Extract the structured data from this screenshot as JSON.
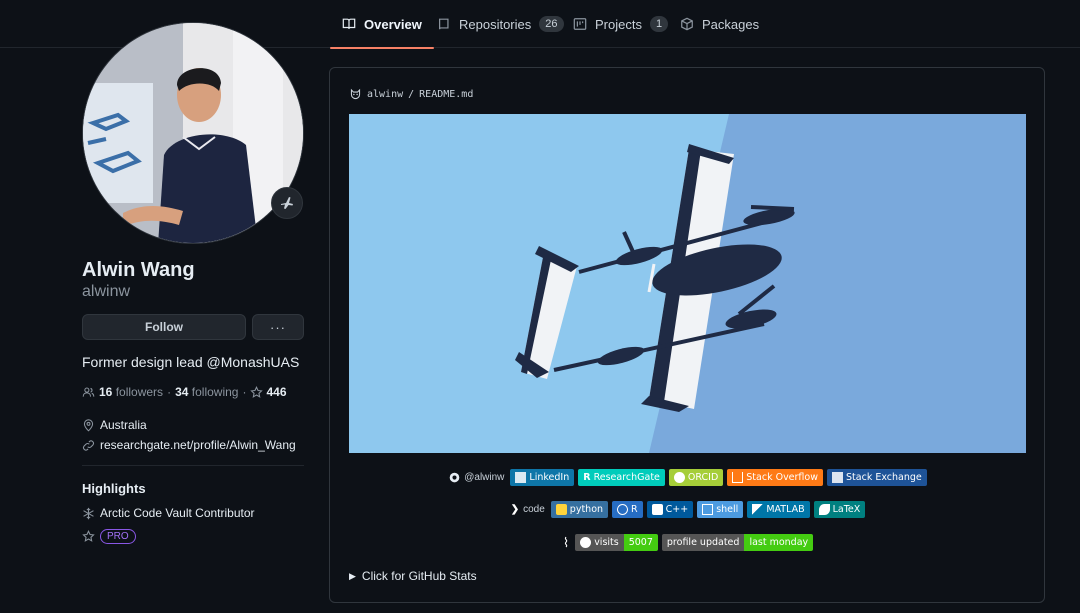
{
  "tabs": [
    {
      "label": "Overview",
      "count": null
    },
    {
      "label": "Repositories",
      "count": "26"
    },
    {
      "label": "Projects",
      "count": "1"
    },
    {
      "label": "Packages",
      "count": null
    }
  ],
  "profile": {
    "full_name": "Alwin Wang",
    "username": "alwinw",
    "follow_label": "Follow",
    "more_label": "···",
    "bio": "Former design lead @MonashUAS",
    "followers_count": "16",
    "followers_label": "followers",
    "following_count": "34",
    "following_label": "following",
    "stars": "446",
    "location": "Australia",
    "website": "researchgate.net/profile/Alwin_Wang",
    "status_icon": "airplane-icon"
  },
  "highlights": {
    "title": "Highlights",
    "items": [
      "Arctic Code Vault Contributor"
    ],
    "pro_label": "PRO"
  },
  "readme": {
    "owner": "alwinw",
    "separator": "/",
    "file": "README.md",
    "banner_colors": {
      "left": "#8ec8ee",
      "right": "#7aa9dc",
      "body": "#f1f3f6",
      "accent": "#1f2a44"
    },
    "social": {
      "handle": "@alwinw",
      "badges": [
        {
          "label": "LinkedIn",
          "color": "#0e76a8",
          "icon": "linkedin-icon"
        },
        {
          "label": "ResearchGate",
          "color": "#00ccbb",
          "icon": "researchgate-icon"
        },
        {
          "label": "ORCID",
          "color": "#a6ce39",
          "icon": "orcid-icon"
        },
        {
          "label": "Stack Overflow",
          "color": "#fe7a16",
          "icon": "stackoverflow-icon"
        },
        {
          "label": "Stack Exchange",
          "color": "#1e5397",
          "icon": "stackexchange-icon"
        }
      ]
    },
    "code": {
      "label": "code",
      "badges": [
        {
          "label": "python",
          "color": "#3670a0",
          "icon": "python-icon"
        },
        {
          "label": "R",
          "color": "#276dc3",
          "icon": "r-icon"
        },
        {
          "label": "C++",
          "color": "#00599c",
          "icon": "cpp-icon"
        },
        {
          "label": "shell",
          "color": "#4d9be0",
          "icon": "shell-icon"
        },
        {
          "label": "MATLAB",
          "color": "#0076a8",
          "icon": "matlab-icon"
        },
        {
          "label": "LaTeX",
          "color": "#008080",
          "icon": "latex-icon"
        }
      ]
    },
    "counters": {
      "visits_label": "visits",
      "visits_value": "5007",
      "updated_label": "profile updated",
      "updated_value": "last monday",
      "value_color": "#4c1"
    },
    "details_label": "Click for GitHub Stats"
  }
}
